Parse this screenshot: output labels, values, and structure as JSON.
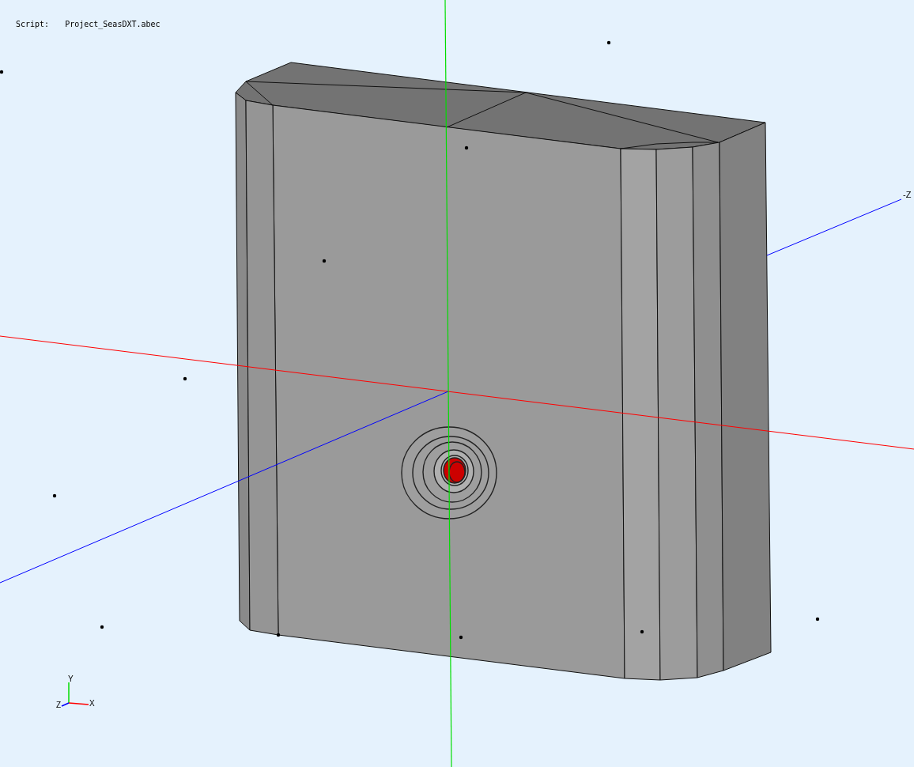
{
  "header": {
    "label": "Script:",
    "value": "Project_SeasDXT.abec"
  },
  "axis_label": "-Z",
  "triad": {
    "y_label": "Y",
    "z_label": "Z",
    "x_label": "X"
  }
}
